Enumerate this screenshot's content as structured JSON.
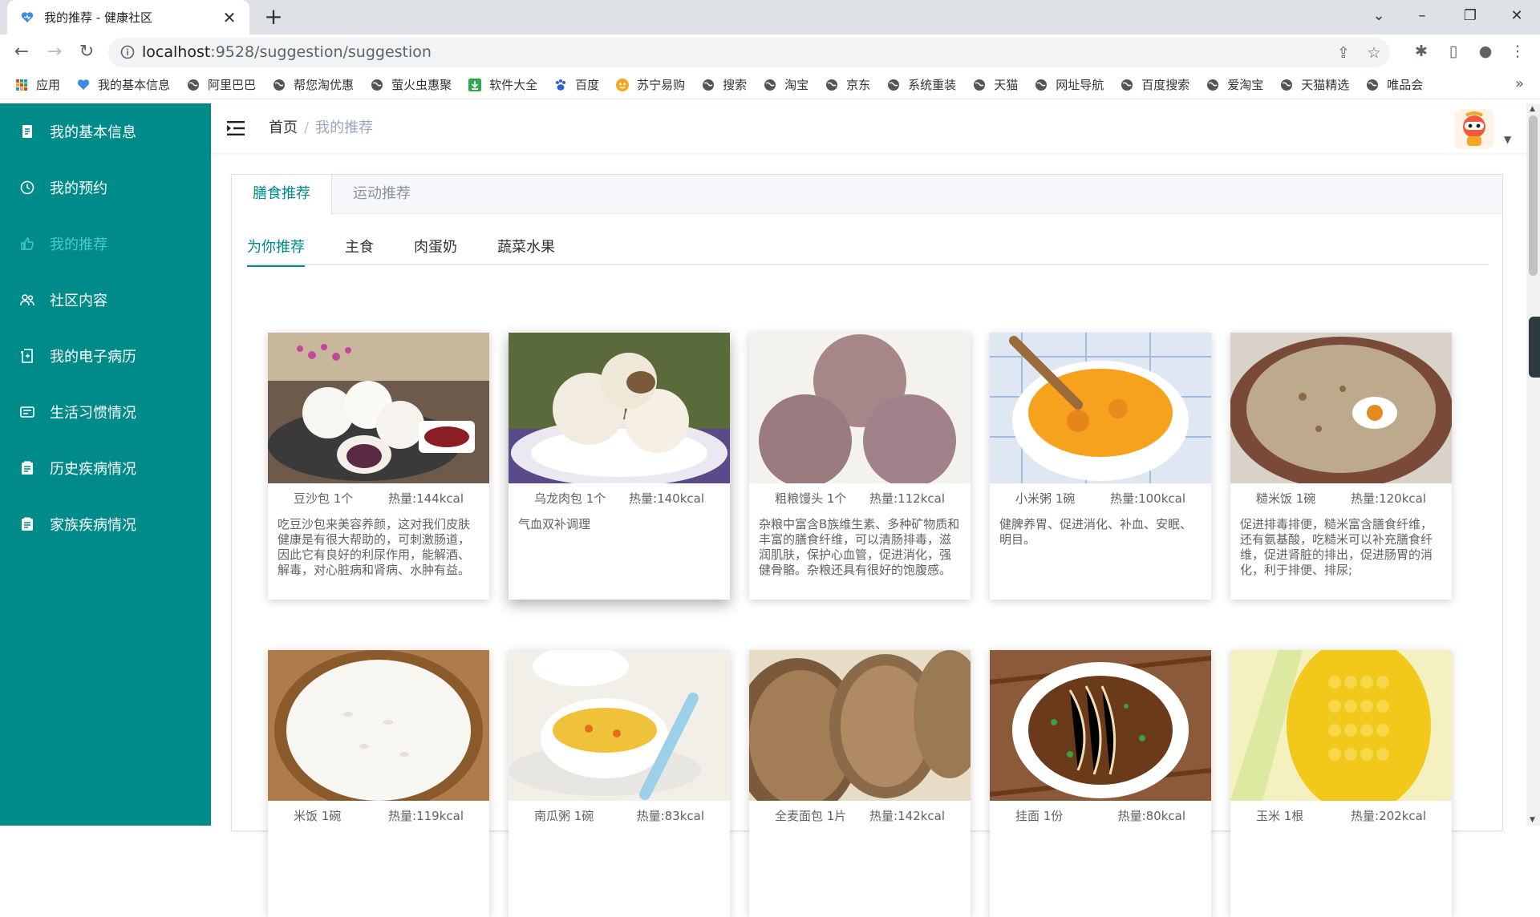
{
  "browser": {
    "tab_title": "我的推荐 - 健康社区",
    "url_host": "localhost",
    "url_path": ":9528/suggestion/suggestion",
    "bookmarks": [
      {
        "label": "应用",
        "icon": "apps-grid-icon",
        "color": "#e34133"
      },
      {
        "label": "我的基本信息",
        "icon": "site-heart-icon",
        "color": "#3b8be0"
      },
      {
        "label": "阿里巴巴",
        "icon": "globe-icon",
        "color": "#555555"
      },
      {
        "label": "帮您淘优惠",
        "icon": "globe-icon",
        "color": "#555555"
      },
      {
        "label": "萤火虫惠聚",
        "icon": "globe-icon",
        "color": "#555555"
      },
      {
        "label": "软件大全",
        "icon": "download-icon",
        "color": "#2ea84a"
      },
      {
        "label": "百度",
        "icon": "baidu-paw-icon",
        "color": "#2f5fd6"
      },
      {
        "label": "苏宁易购",
        "icon": "suning-icon",
        "color": "#f5a623"
      },
      {
        "label": "搜索",
        "icon": "globe-icon",
        "color": "#555555"
      },
      {
        "label": "淘宝",
        "icon": "globe-icon",
        "color": "#555555"
      },
      {
        "label": "京东",
        "icon": "globe-icon",
        "color": "#555555"
      },
      {
        "label": "系统重装",
        "icon": "globe-icon",
        "color": "#555555"
      },
      {
        "label": "天猫",
        "icon": "globe-icon",
        "color": "#555555"
      },
      {
        "label": "网址导航",
        "icon": "globe-icon",
        "color": "#555555"
      },
      {
        "label": "百度搜索",
        "icon": "globe-icon",
        "color": "#555555"
      },
      {
        "label": "爱淘宝",
        "icon": "globe-icon",
        "color": "#555555"
      },
      {
        "label": "天猫精选",
        "icon": "globe-icon",
        "color": "#555555"
      },
      {
        "label": "唯品会",
        "icon": "globe-icon",
        "color": "#555555"
      }
    ],
    "bookmarks_more": "»"
  },
  "sidebar": {
    "items": [
      {
        "label": "我的基本信息",
        "icon": "document-icon",
        "active": false
      },
      {
        "label": "我的预约",
        "icon": "clock-icon",
        "active": false
      },
      {
        "label": "我的推荐",
        "icon": "recommend-icon",
        "active": true
      },
      {
        "label": "社区内容",
        "icon": "community-icon",
        "active": false
      },
      {
        "label": "我的电子病历",
        "icon": "medical-record-icon",
        "active": false
      },
      {
        "label": "生活习惯情况",
        "icon": "habit-icon",
        "active": false
      },
      {
        "label": "历史疾病情况",
        "icon": "history-icon",
        "active": false
      },
      {
        "label": "家族疾病情况",
        "icon": "family-icon",
        "active": false
      }
    ]
  },
  "navbar": {
    "breadcrumb_home": "首页",
    "breadcrumb_sep": "/",
    "breadcrumb_current": "我的推荐"
  },
  "tabs": {
    "outer": [
      "膳食推荐",
      "运动推荐"
    ],
    "inner": [
      "为你推荐",
      "主食",
      "肉蛋奶",
      "蔬菜水果"
    ]
  },
  "foods": [
    {
      "name": "豆沙包 1个",
      "kcal": "热量:144kcal",
      "desc": "吃豆沙包来美容养颜，这对我们皮肤健康是有很大帮助的，可刺激肠道，因此它有良好的利尿作用，能解酒、解毒，对心脏病和肾病、水肿有益。"
    },
    {
      "name": "乌龙肉包 1个",
      "kcal": "热量:140kcal",
      "desc": "气血双补调理"
    },
    {
      "name": "粗粮馒头 1个",
      "kcal": "热量:112kcal",
      "desc": "杂粮中富含B族维生素、多种矿物质和丰富的膳食纤维，可以清肠排毒，滋润肌肤，保护心血管，促进消化，强健骨骼。杂粮还具有很好的饱腹感。"
    },
    {
      "name": "小米粥 1碗",
      "kcal": "热量:100kcal",
      "desc": "健脾养胃、促进消化、补血、安眠、明目。"
    },
    {
      "name": "糙米饭 1碗",
      "kcal": "热量:120kcal",
      "desc": "促进排毒排便，糙米富含膳食纤维，还有氨基酸，吃糙米可以补充膳食纤维，促进肾脏的排出，促进肠胃的消化，利于排便、排尿;"
    },
    {
      "name": "米饭 1碗",
      "kcal": "热量:119kcal",
      "desc": ""
    },
    {
      "name": "南瓜粥 1碗",
      "kcal": "热量:83kcal",
      "desc": ""
    },
    {
      "name": "全麦面包 1片",
      "kcal": "热量:142kcal",
      "desc": ""
    },
    {
      "name": "挂面 1份",
      "kcal": "热量:80kcal",
      "desc": ""
    },
    {
      "name": "玉米 1根",
      "kcal": "热量:202kcal",
      "desc": ""
    }
  ],
  "colors": {
    "sidebar_bg": "#008b8b",
    "accent": "#008b8b",
    "sidebar_active_text": "#4fc8c2"
  }
}
